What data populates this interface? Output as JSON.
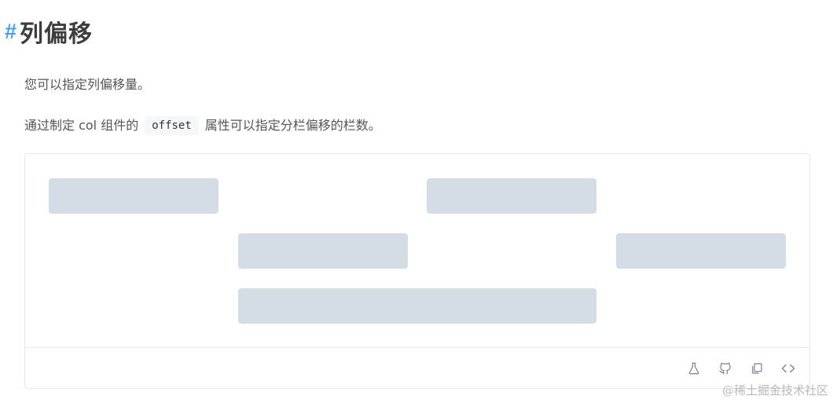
{
  "heading": {
    "hash": "#",
    "title": "列偏移"
  },
  "intro": "您可以指定列偏移量。",
  "desc": {
    "before": "通过制定 col 组件的",
    "code": "offset",
    "after": "属性可以指定分栏偏移的栏数。"
  },
  "toolbar": {
    "icons": [
      "flask-icon",
      "github-icon",
      "copy-icon",
      "code-icon"
    ]
  },
  "watermark": "@稀土掘金技术社区",
  "colors": {
    "block": "#d4dde6",
    "hash": "#4a9ff5",
    "border": "#e6e9ee"
  }
}
